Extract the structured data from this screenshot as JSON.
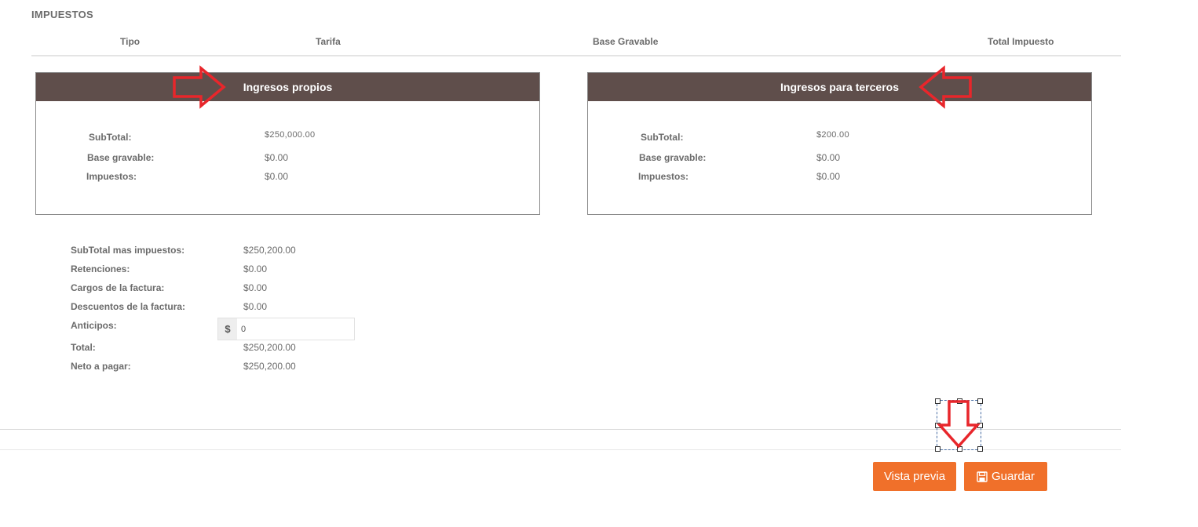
{
  "section": {
    "title": "IMPUESTOS"
  },
  "tax_table": {
    "columns": [
      "Tipo",
      "Tarifa",
      "Base Gravable",
      "Total Impuesto"
    ]
  },
  "panels": {
    "own": {
      "title": "Ingresos propios",
      "subtotal_label": "SubTotal:",
      "subtotal_value": "$250,000.00",
      "base_label": "Base gravable:",
      "base_value": "$0.00",
      "tax_label": "Impuestos:",
      "tax_value": "$0.00"
    },
    "third": {
      "title": "Ingresos para terceros",
      "subtotal_label": "SubTotal:",
      "subtotal_value": "$200.00",
      "base_label": "Base gravable:",
      "base_value": "$0.00",
      "tax_label": "Impuestos:",
      "tax_value": "$0.00"
    }
  },
  "summary": {
    "subtotal_taxes_label": "SubTotal mas impuestos:",
    "subtotal_taxes_value": "$250,200.00",
    "retentions_label": "Retenciones:",
    "retentions_value": "$0.00",
    "charges_label": "Cargos de la factura:",
    "charges_value": "$0.00",
    "discounts_label": "Descuentos de la factura:",
    "discounts_value": "$0.00",
    "advances_label": "Anticipos:",
    "advances_currency": "$",
    "advances_value": "0",
    "total_label": "Total:",
    "total_value": "$250,200.00",
    "net_label": "Neto a pagar:",
    "net_value": "$250,200.00"
  },
  "actions": {
    "preview_label": "Vista previa",
    "save_label": "Guardar"
  },
  "colors": {
    "panel_header": "#5f4e4b",
    "button": "#f0702a",
    "annotation_arrow": "#e8262b"
  },
  "icons": {
    "save": "floppy-disk-icon",
    "annotation": "outline-arrow-icon"
  }
}
